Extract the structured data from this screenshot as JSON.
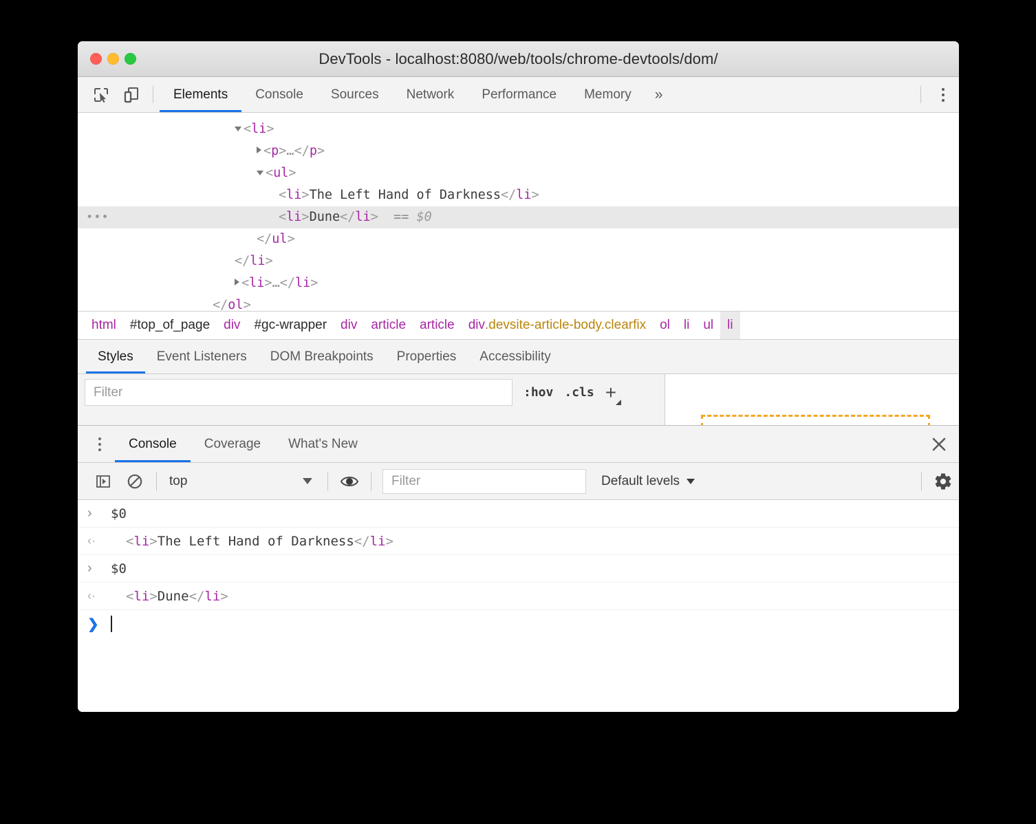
{
  "window": {
    "title": "DevTools - localhost:8080/web/tools/chrome-devtools/dom/",
    "traffic_lights": [
      "close",
      "minimize",
      "zoom"
    ]
  },
  "main_toolbar": {
    "icons": [
      "inspect-element-icon",
      "device-toolbar-icon"
    ],
    "tabs": [
      {
        "label": "Elements",
        "active": true
      },
      {
        "label": "Console",
        "active": false
      },
      {
        "label": "Sources",
        "active": false
      },
      {
        "label": "Network",
        "active": false
      },
      {
        "label": "Performance",
        "active": false
      },
      {
        "label": "Memory",
        "active": false
      }
    ],
    "more_tabs_label": "»",
    "menu_icon": "kebab-menu-icon",
    "accent_color": "#1a73e8"
  },
  "dom_tree": {
    "rows": [
      {
        "indent": 0,
        "twisty": "open",
        "gutter": "",
        "selected": false,
        "parts": [
          {
            "t": "br",
            "v": "<"
          },
          {
            "t": "tag",
            "v": "li"
          },
          {
            "t": "br",
            "v": ">"
          }
        ]
      },
      {
        "indent": 1,
        "twisty": "closed",
        "gutter": "",
        "selected": false,
        "parts": [
          {
            "t": "br",
            "v": "<"
          },
          {
            "t": "tag",
            "v": "p"
          },
          {
            "t": "br",
            "v": ">"
          },
          {
            "t": "dots",
            "v": "…"
          },
          {
            "t": "br",
            "v": "</"
          },
          {
            "t": "tag",
            "v": "p"
          },
          {
            "t": "br",
            "v": ">"
          }
        ]
      },
      {
        "indent": 1,
        "twisty": "open",
        "gutter": "",
        "selected": false,
        "parts": [
          {
            "t": "br",
            "v": "<"
          },
          {
            "t": "tag",
            "v": "ul"
          },
          {
            "t": "br",
            "v": ">"
          }
        ]
      },
      {
        "indent": 2,
        "twisty": "none",
        "gutter": "",
        "selected": false,
        "parts": [
          {
            "t": "br",
            "v": "<"
          },
          {
            "t": "tag",
            "v": "li"
          },
          {
            "t": "br",
            "v": ">"
          },
          {
            "t": "txt",
            "v": "The Left Hand of Darkness"
          },
          {
            "t": "br",
            "v": "</"
          },
          {
            "t": "tag",
            "v": "li"
          },
          {
            "t": "br",
            "v": ">"
          }
        ]
      },
      {
        "indent": 2,
        "twisty": "none",
        "gutter": "…",
        "selected": true,
        "parts": [
          {
            "t": "br",
            "v": "<"
          },
          {
            "t": "tag",
            "v": "li"
          },
          {
            "t": "br",
            "v": ">"
          },
          {
            "t": "txt",
            "v": "Dune"
          },
          {
            "t": "br",
            "v": "</"
          },
          {
            "t": "tag",
            "v": "li"
          },
          {
            "t": "br",
            "v": ">"
          },
          {
            "t": "eqs",
            "v": "  =="
          },
          {
            "t": "dollar",
            "v": " $0"
          }
        ]
      },
      {
        "indent": 1,
        "twisty": "none",
        "gutter": "",
        "selected": false,
        "parts": [
          {
            "t": "br",
            "v": "</"
          },
          {
            "t": "tag",
            "v": "ul"
          },
          {
            "t": "br",
            "v": ">"
          }
        ]
      },
      {
        "indent": 0,
        "twisty": "none",
        "gutter": "",
        "selected": false,
        "parts": [
          {
            "t": "br",
            "v": "</"
          },
          {
            "t": "tag",
            "v": "li"
          },
          {
            "t": "br",
            "v": ">"
          }
        ]
      },
      {
        "indent": 0,
        "twisty": "closed",
        "gutter": "",
        "selected": false,
        "parts": [
          {
            "t": "br",
            "v": "<"
          },
          {
            "t": "tag",
            "v": "li"
          },
          {
            "t": "br",
            "v": ">"
          },
          {
            "t": "dots",
            "v": "…"
          },
          {
            "t": "br",
            "v": "</"
          },
          {
            "t": "tag",
            "v": "li"
          },
          {
            "t": "br",
            "v": ">"
          }
        ]
      },
      {
        "indent": -1,
        "twisty": "none",
        "gutter": "",
        "selected": false,
        "parts": [
          {
            "t": "br",
            "v": "</"
          },
          {
            "t": "tag",
            "v": "ol"
          },
          {
            "t": "br",
            "v": ">"
          }
        ]
      }
    ]
  },
  "breadcrumb": {
    "items": [
      {
        "label": "html",
        "kind": "tag",
        "selected": false
      },
      {
        "label": "#top_of_page",
        "kind": "id",
        "selected": false
      },
      {
        "label": "div",
        "kind": "tag",
        "selected": false
      },
      {
        "label": "#gc-wrapper",
        "kind": "id",
        "selected": false
      },
      {
        "label": "div",
        "kind": "tag",
        "selected": false
      },
      {
        "label": "article",
        "kind": "tag",
        "selected": false
      },
      {
        "label": "article",
        "kind": "tag",
        "selected": false
      },
      {
        "label": "div.devsite-article-body.clearfix",
        "kind": "tagcls",
        "selected": false
      },
      {
        "label": "ol",
        "kind": "tag",
        "selected": false
      },
      {
        "label": "li",
        "kind": "tag",
        "selected": false
      },
      {
        "label": "ul",
        "kind": "tag",
        "selected": false
      },
      {
        "label": "li",
        "kind": "tag",
        "selected": true
      }
    ]
  },
  "sidebar_tabs": {
    "tabs": [
      {
        "label": "Styles",
        "active": true
      },
      {
        "label": "Event Listeners",
        "active": false
      },
      {
        "label": "DOM Breakpoints",
        "active": false
      },
      {
        "label": "Properties",
        "active": false
      },
      {
        "label": "Accessibility",
        "active": false
      }
    ]
  },
  "styles_pane": {
    "filter_placeholder": "Filter",
    "filter_value": "",
    "hov_label": ":hov",
    "cls_label": ".cls",
    "new_rule_label": "+",
    "box_model_margin_color": "#f5a623"
  },
  "drawer": {
    "menu_icon": "kebab-menu-icon",
    "tabs": [
      {
        "label": "Console",
        "active": true
      },
      {
        "label": "Coverage",
        "active": false
      },
      {
        "label": "What's New",
        "active": false
      }
    ],
    "close_icon": "close-icon"
  },
  "console_toolbar": {
    "sidebar_toggle_icon": "console-sidebar-icon",
    "clear_icon": "clear-console-icon",
    "context_value": "top",
    "eye_icon": "live-expression-icon",
    "filter_placeholder": "Filter",
    "filter_value": "",
    "levels_label": "Default levels",
    "settings_icon": "gear-icon"
  },
  "console_messages": [
    {
      "kind": "input",
      "marker": "›",
      "parts": [
        {
          "t": "txt",
          "v": "$0"
        }
      ]
    },
    {
      "kind": "result",
      "marker": "‹·",
      "parts": [
        {
          "t": "br",
          "v": "<"
        },
        {
          "t": "tag",
          "v": "li"
        },
        {
          "t": "br",
          "v": ">"
        },
        {
          "t": "txt",
          "v": "The Left Hand of Darkness"
        },
        {
          "t": "br",
          "v": "</"
        },
        {
          "t": "tag",
          "v": "li"
        },
        {
          "t": "br",
          "v": ">"
        }
      ]
    },
    {
      "kind": "input",
      "marker": "›",
      "parts": [
        {
          "t": "txt",
          "v": "$0"
        }
      ]
    },
    {
      "kind": "result",
      "marker": "‹·",
      "parts": [
        {
          "t": "br",
          "v": "<"
        },
        {
          "t": "tag",
          "v": "li"
        },
        {
          "t": "br",
          "v": ">"
        },
        {
          "t": "txt",
          "v": "Dune"
        },
        {
          "t": "br",
          "v": "</"
        },
        {
          "t": "tag",
          "v": "li"
        },
        {
          "t": "br",
          "v": ">"
        }
      ]
    },
    {
      "kind": "prompt",
      "marker": "❯",
      "parts": []
    }
  ],
  "colors": {
    "tag": "#a626a4",
    "bracket": "#9a9a9a",
    "text": "#3b3b3b",
    "class": "#b8860b",
    "accent": "#1a73e8",
    "selected_row": "#e8e8e8"
  }
}
